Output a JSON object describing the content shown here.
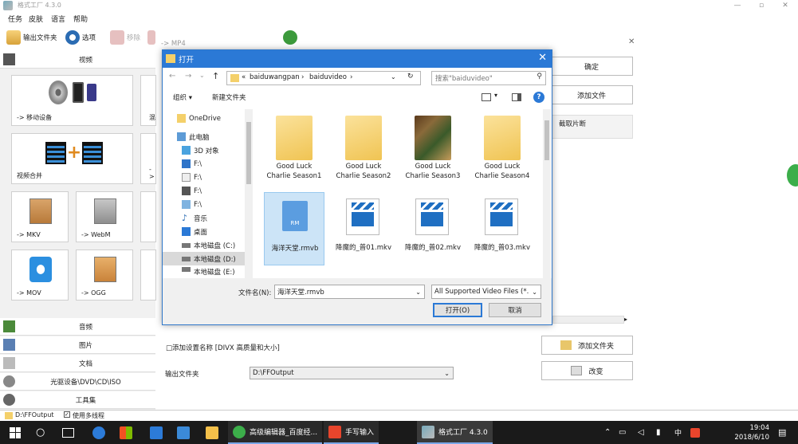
{
  "app": {
    "title": "格式工厂 4.3.0",
    "menu": [
      "任务",
      "皮肤",
      "语言",
      "帮助"
    ],
    "toolbar": {
      "output_folder": "输出文件夹",
      "options": "选项",
      "remove": "移除",
      "target": "-> MP4"
    },
    "left": {
      "video_header": "视频",
      "tiles": [
        {
          "label": "-> 移动设备"
        },
        {
          "label": "视频合并"
        },
        {
          "label": "-> MKV"
        },
        {
          "label": "-> WebM"
        },
        {
          "label": "-> MOV"
        },
        {
          "label": "-> OGG"
        }
      ],
      "partial_labels": [
        "混",
        "->"
      ],
      "categories": [
        "音频",
        "图片",
        "文档",
        "光驱设备\\DVD\\CD\\ISO",
        "工具集"
      ]
    },
    "right": {
      "ok": "确定",
      "add_file": "添加文件",
      "clip": "截取片断",
      "add_settings_name": "添加设置名称 [DIVX 高质量和大小]",
      "output_folder_label": "输出文件夹",
      "output_folder_value": "D:\\FFOutput",
      "add_folder": "添加文件夹",
      "change": "改变"
    },
    "status": {
      "path": "D:\\FFOutput",
      "multithread": "使用多线程"
    }
  },
  "dialog": {
    "title": "打开",
    "breadcrumb": [
      "«",
      "baiduwangpan",
      "›",
      "baiduvideo",
      "›"
    ],
    "search_placeholder": "搜索\"baiduvideo\"",
    "organize": "组织 ▾",
    "new_folder": "新建文件夹",
    "nav": [
      {
        "label": "OneDrive",
        "icon": "folder-icon"
      },
      {
        "label": "此电脑",
        "icon": "computer-icon"
      },
      {
        "label": "3D 对象",
        "icon": "cube-icon"
      },
      {
        "label": "F:\\",
        "icon": "download-icon"
      },
      {
        "label": "F:\\",
        "icon": "document-icon"
      },
      {
        "label": "F:\\",
        "icon": "film-icon"
      },
      {
        "label": "F:\\",
        "icon": "picture-icon"
      },
      {
        "label": "音乐",
        "icon": "music-icon"
      },
      {
        "label": "桌面",
        "icon": "desktop-icon"
      },
      {
        "label": "本地磁盘 (C:)",
        "icon": "drive-icon"
      },
      {
        "label": "本地磁盘 (D:)",
        "icon": "drive-icon"
      },
      {
        "label": "本地磁盘 (E:)",
        "icon": "drive-icon"
      }
    ],
    "files": [
      {
        "label": "Good Luck Charlie Season1",
        "type": "folder"
      },
      {
        "label": "Good Luck Charlie Season2",
        "type": "folder"
      },
      {
        "label": "Good Luck Charlie Season3",
        "type": "folder-photo"
      },
      {
        "label": "Good Luck Charlie Season4",
        "type": "folder"
      },
      {
        "label": "海洋天堂.rmvb",
        "type": "rm",
        "badge": "RM"
      },
      {
        "label": "降魔的_普01.mkv",
        "type": "video"
      },
      {
        "label": "降魔的_普02.mkv",
        "type": "video"
      },
      {
        "label": "降魔的_普03.mkv",
        "type": "video"
      }
    ],
    "filename_label": "文件名(N):",
    "filename_value": "海洋天堂.rmvb",
    "filter_value": "All Supported Video Files (*.",
    "open_btn": "打开(O)",
    "cancel_btn": "取消"
  },
  "taskbar": {
    "apps": [
      {
        "label": "高级编辑器_百度经..."
      },
      {
        "label": "手写输入"
      },
      {
        "label": "格式工厂 4.3.0"
      }
    ],
    "ime": "中",
    "time": "19:04",
    "date": "2018/6/10"
  },
  "colors": {
    "dialog_title": "#2b79d6",
    "selection": "#cce4f7",
    "taskbar": "#1a1a1a"
  }
}
